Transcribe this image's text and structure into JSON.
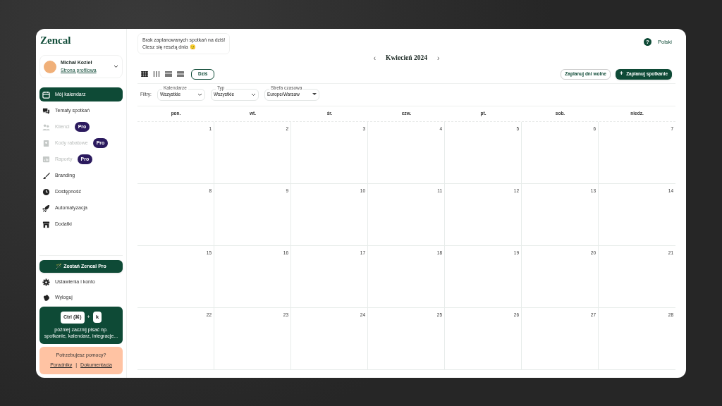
{
  "logo": "Zencal",
  "user": {
    "name": "Michał Kozieł",
    "link": "Strona profilowa"
  },
  "nav": [
    {
      "label": "Mój kalendarz",
      "selected": true,
      "disabled": false
    },
    {
      "label": "Tematy spotkań",
      "selected": false,
      "disabled": false
    },
    {
      "label": "Klienci",
      "selected": false,
      "disabled": true,
      "badge": "Pro"
    },
    {
      "label": "Kody rabatowe",
      "selected": false,
      "disabled": true,
      "badge": "Pro"
    },
    {
      "label": "Raporty",
      "selected": false,
      "disabled": true,
      "badge": "Pro"
    },
    {
      "label": "Branding",
      "selected": false,
      "disabled": false
    },
    {
      "label": "Dostępność",
      "selected": false,
      "disabled": false
    },
    {
      "label": "Automatyzacja",
      "selected": false,
      "disabled": false
    },
    {
      "label": "Dodatki",
      "selected": false,
      "disabled": false
    }
  ],
  "upgrade_button": "🪄 Zostań Zencal Pro",
  "bottom_nav": [
    "Ustawienia i konto",
    "Wyloguj"
  ],
  "shortcut": {
    "key_1": "Ctrl (⌘)",
    "plus": "+",
    "key_2": "k",
    "hint": "później zacznij pisać np. spotkanie, kalendarz, integracje..."
  },
  "help": {
    "title": "Potrzebujesz pomocy?",
    "link_1": "Poradniky",
    "separator": "|",
    "link_2": "Dokumentacja"
  },
  "notice": [
    "Brak zaplanowanych spotkań na dziś!",
    "Ciesz się resztą dnia 🙂"
  ],
  "help_icon": "?",
  "language": "Polski",
  "month": {
    "prev": "‹",
    "title": "Kwiecień 2024",
    "next": "›"
  },
  "views": [
    {
      "selected": true
    },
    {
      "selected": false
    },
    {
      "selected": false
    },
    {
      "selected": false
    }
  ],
  "today_button": "Dziś",
  "days_off_button": "Zaplanuj dni wolne",
  "schedule_button": {
    "icon": "+",
    "label": "Zaplanuj spotkanie"
  },
  "filters": {
    "label": "Filtry:",
    "fields": [
      {
        "label": "Kalendarze",
        "value": "Wszystkie",
        "kind": "chevron"
      },
      {
        "label": "Typ",
        "value": "Wszystkie",
        "kind": "chevron"
      },
      {
        "label": "Strefa czasowa",
        "value": "Europe/Warsaw",
        "kind": "triangle"
      }
    ]
  },
  "weekdays": [
    "pon.",
    "wt.",
    "śr.",
    "czw.",
    "pt.",
    "sob.",
    "niedz."
  ],
  "weeks": [
    [
      "1",
      "2",
      "3",
      "4",
      "5",
      "6",
      "7"
    ],
    [
      "8",
      "9",
      "10",
      "11",
      "12",
      "13",
      "14"
    ],
    [
      "15",
      "16",
      "17",
      "18",
      "19",
      "20",
      "21"
    ],
    [
      "22",
      "23",
      "24",
      "25",
      "26",
      "27",
      "28"
    ]
  ]
}
